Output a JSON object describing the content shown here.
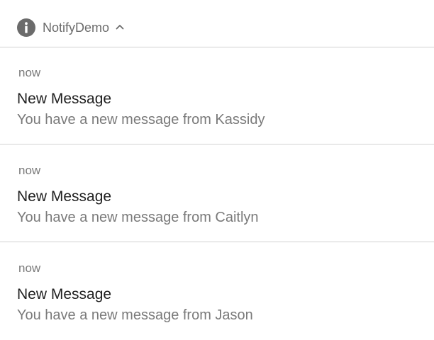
{
  "header": {
    "app_name": "NotifyDemo",
    "app_icon": "info-icon",
    "expand_icon": "chevron-up-icon",
    "icon_color": "#6b6b6b"
  },
  "notifications": [
    {
      "time": "now",
      "title": "New Message",
      "text": "You have a new message from Kassidy"
    },
    {
      "time": "now",
      "title": "New Message",
      "text": "You have a new message from Caitlyn"
    },
    {
      "time": "now",
      "title": "New Message",
      "text": "You have a new message from Jason"
    }
  ]
}
